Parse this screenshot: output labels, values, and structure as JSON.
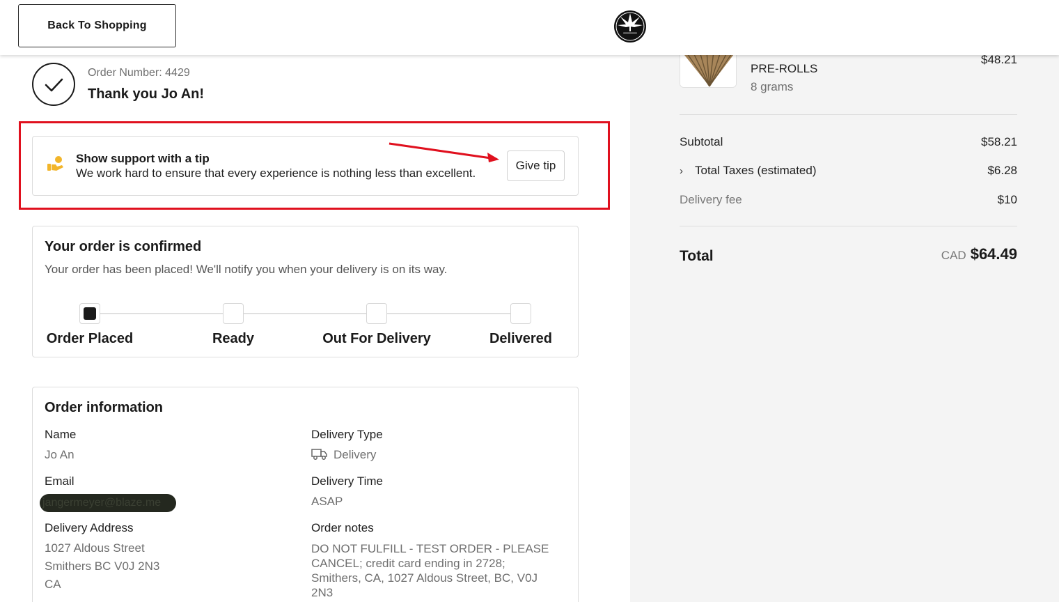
{
  "header": {
    "back_label": "Back To Shopping",
    "logo_icon": "cannabis-leaf-logo"
  },
  "order": {
    "number_label": "Order Number: 4429",
    "thank_you": "Thank you Jo An!"
  },
  "tip": {
    "title": "Show support with a tip",
    "description": "We work hard to ensure that every experience is nothing less than excellent.",
    "button_label": "Give tip",
    "highlight_color": "#e0101e"
  },
  "confirmation": {
    "title": "Your order is confirmed",
    "description": "Your order has been placed! We'll notify you when your delivery is on its way.",
    "steps": [
      {
        "label": "Order Placed",
        "active": true
      },
      {
        "label": "Ready",
        "active": false
      },
      {
        "label": "Out For Delivery",
        "active": false
      },
      {
        "label": "Delivered",
        "active": false
      }
    ]
  },
  "info": {
    "title": "Order information",
    "name_label": "Name",
    "name_value": "Jo An",
    "email_label": "Email",
    "email_value": "jangermeyer@blaze.me",
    "address_label": "Delivery Address",
    "address_line1": "1027 Aldous Street",
    "address_line2": "Smithers BC V0J 2N3",
    "address_line3": "CA",
    "delivery_type_label": "Delivery Type",
    "delivery_type_value": "Delivery",
    "delivery_time_label": "Delivery Time",
    "delivery_time_value": "ASAP",
    "notes_label": "Order notes",
    "notes_line1": "DO NOT FULFILL - TEST ORDER - PLEASE",
    "notes_line2": "CANCEL; credit card ending in 2728;",
    "notes_line3": "Smithers, CA, 1027 Aldous Street, BC, V0J",
    "notes_line4": "2N3"
  },
  "summary": {
    "product": {
      "category": "PRE-ROLLS",
      "weight": "8 grams",
      "price": "$48.21"
    },
    "subtotal_label": "Subtotal",
    "subtotal_value": "$58.21",
    "taxes_label": "Total Taxes (estimated)",
    "taxes_value": "$6.28",
    "delivery_fee_label": "Delivery fee",
    "delivery_fee_value": "$10",
    "total_label": "Total",
    "total_currency": "CAD",
    "total_value": "$64.49"
  }
}
